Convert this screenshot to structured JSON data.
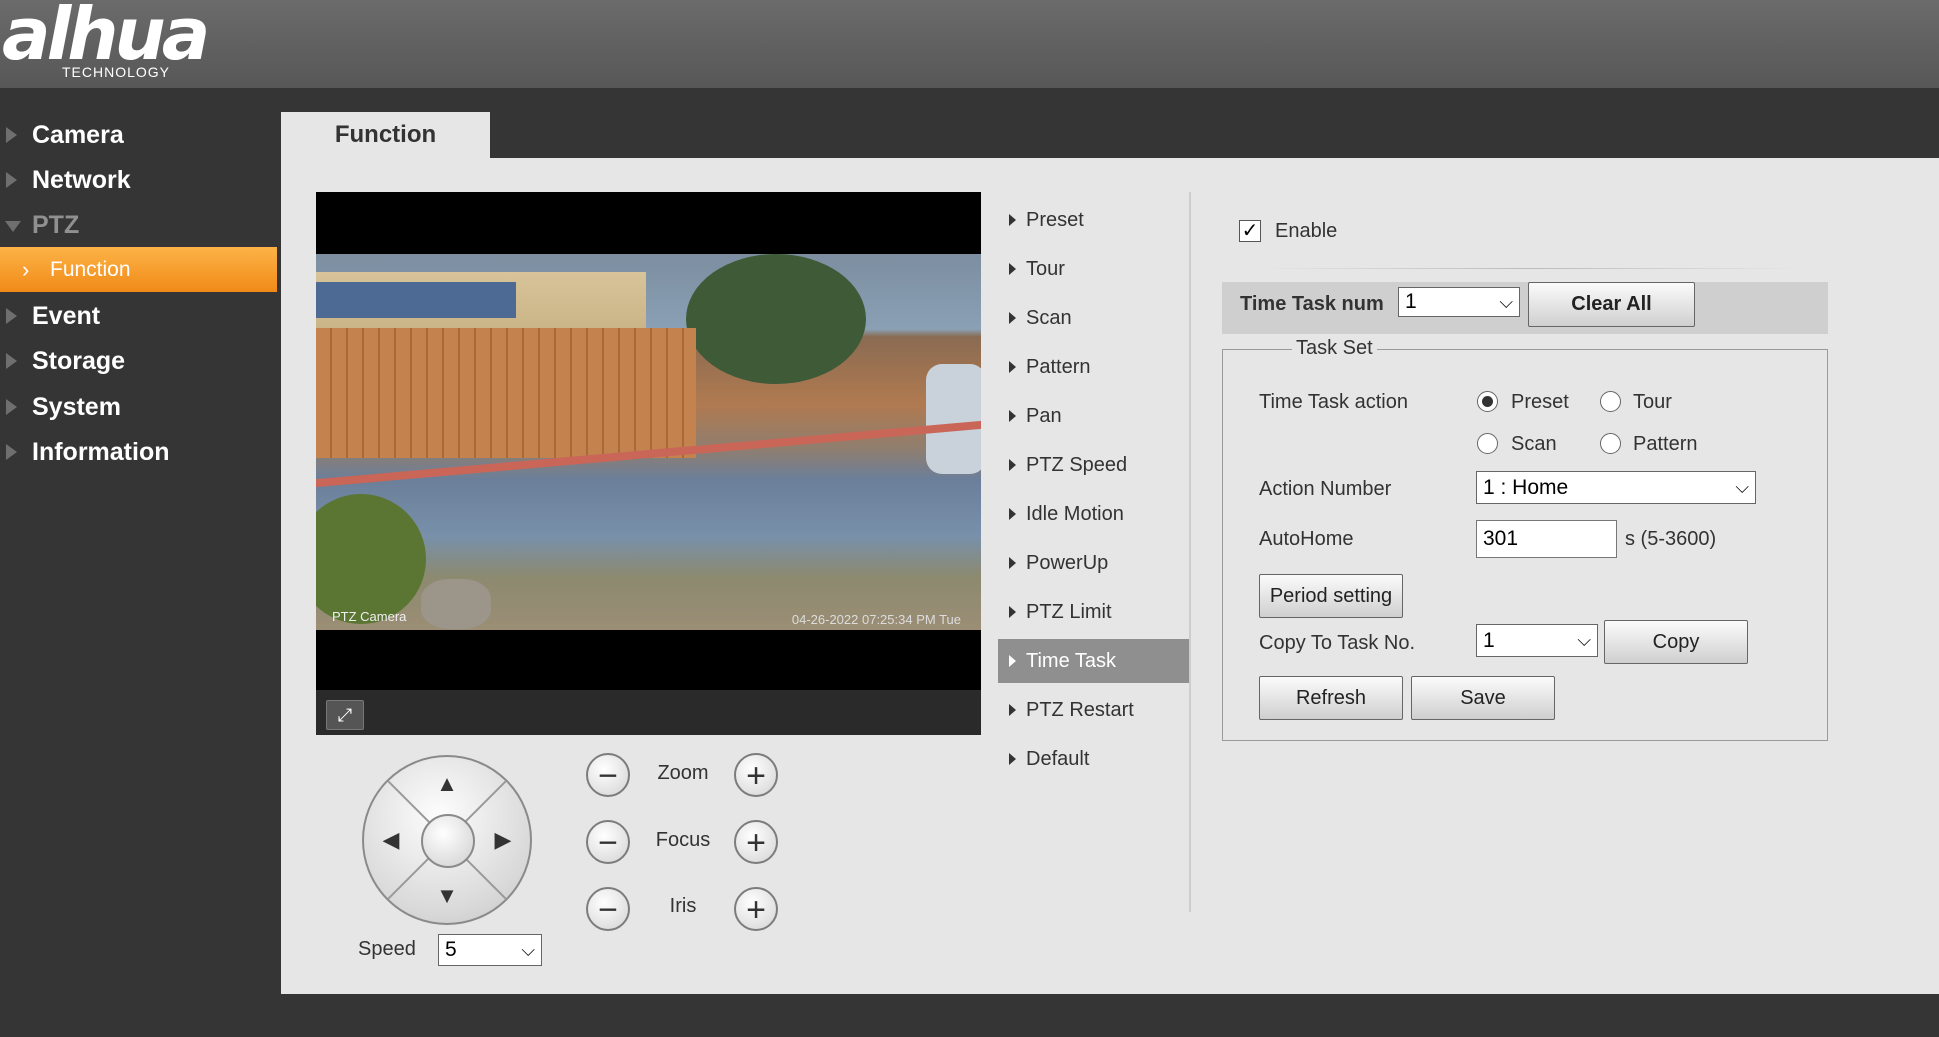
{
  "header": {
    "brand": "alhua",
    "brand_sub": "TECHNOLOGY"
  },
  "sidebar": {
    "items": [
      {
        "label": "Camera"
      },
      {
        "label": "Network"
      },
      {
        "label": "PTZ"
      },
      {
        "label": "Event"
      },
      {
        "label": "Storage"
      },
      {
        "label": "System"
      },
      {
        "label": "Information"
      }
    ],
    "active_sub": "Function"
  },
  "tab": {
    "label": "Function"
  },
  "video": {
    "osd_name": "PTZ Camera",
    "osd_time": "04-26-2022 07:25:34 PM Tue"
  },
  "ptz": {
    "zoom_label": "Zoom",
    "focus_label": "Focus",
    "iris_label": "Iris",
    "speed_label": "Speed",
    "speed_value": "5"
  },
  "menu": {
    "items": [
      {
        "label": "Preset"
      },
      {
        "label": "Tour"
      },
      {
        "label": "Scan"
      },
      {
        "label": "Pattern"
      },
      {
        "label": "Pan"
      },
      {
        "label": "PTZ Speed"
      },
      {
        "label": "Idle Motion"
      },
      {
        "label": "PowerUp"
      },
      {
        "label": "PTZ Limit"
      },
      {
        "label": "Time Task"
      },
      {
        "label": "PTZ Restart"
      },
      {
        "label": "Default"
      }
    ],
    "active": "Time Task"
  },
  "panel": {
    "enable_label": "Enable",
    "enable_checked": true,
    "task_num_label": "Time Task num",
    "task_num_value": "1",
    "clear_all_label": "Clear All",
    "task_set_legend": "Task Set",
    "action_label": "Time Task action",
    "actions": [
      {
        "label": "Preset",
        "checked": true
      },
      {
        "label": "Tour",
        "checked": false
      },
      {
        "label": "Scan",
        "checked": false
      },
      {
        "label": "Pattern",
        "checked": false
      }
    ],
    "action_number_label": "Action Number",
    "action_number_value": "1 : Home",
    "autohome_label": "AutoHome",
    "autohome_value": "301",
    "autohome_unit": "s (5-3600)",
    "period_setting_label": "Period setting",
    "copy_to_label": "Copy To Task No.",
    "copy_to_value": "1",
    "copy_label": "Copy",
    "refresh_label": "Refresh",
    "save_label": "Save"
  }
}
